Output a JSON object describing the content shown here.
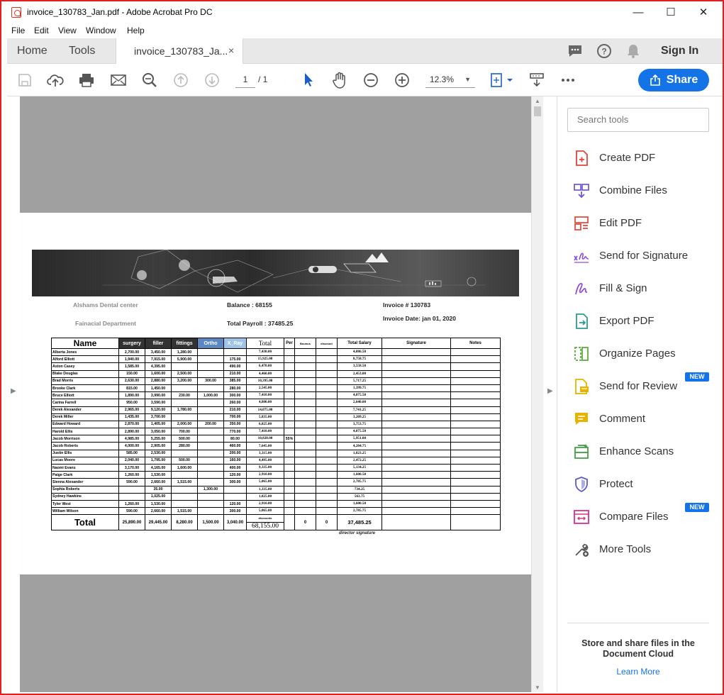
{
  "window": {
    "title": "invoice_130783_Jan.pdf - Adobe Acrobat Pro DC",
    "minimize": "—",
    "maximize": "☐",
    "close": "✕"
  },
  "menu": [
    "File",
    "Edit",
    "View",
    "Window",
    "Help"
  ],
  "tabs": {
    "home": "Home",
    "tools": "Tools",
    "document": "invoice_130783_Ja...",
    "close": "×",
    "sign_in": "Sign In"
  },
  "toolbar": {
    "page_current": "1",
    "page_total": "/ 1",
    "zoom": "12.3%",
    "share": "Share"
  },
  "invoice": {
    "company": "Alshams Dental center",
    "department": "Fainacial Department",
    "balance": "Balance : 68155",
    "total_payroll": "Total Payroll : 37485.25",
    "invoice_no": "Invoice # 130783",
    "invoice_date": "Invoice Date: jan 01, 2020",
    "director_signature": "director signature",
    "headers": [
      "Name",
      "surgery",
      "filler",
      "fittings",
      "Ortho",
      "X_Ray",
      "Total",
      "Per",
      "Bounus",
      "discount",
      "Total Salary",
      "Signature",
      "Notes"
    ],
    "rows": [
      {
        "name": "Alberta Jones",
        "surgery": "2,700.00",
        "filler": "3,450.00",
        "fittings": "1,280.00",
        "ortho": "",
        "xray": "",
        "total": "7,430.00",
        "per": "",
        "salary": "4,086.50"
      },
      {
        "name": "Alford Elliott",
        "surgery": "1,940.00",
        "filler": "7,915.00",
        "fittings": "5,900.00",
        "ortho": "",
        "xray": "175.00",
        "total": "15,925.00",
        "per": "",
        "salary": "8,758.75"
      },
      {
        "name": "Aston Casey",
        "surgery": "1,585.00",
        "filler": "4,395.00",
        "fittings": "",
        "ortho": "",
        "xray": "490.00",
        "total": "6,470.00",
        "per": "",
        "salary": "3,558.50"
      },
      {
        "name": "Blake Douglas",
        "surgery": "150.00",
        "filler": "1,600.00",
        "fittings": "2,500.00",
        "ortho": "",
        "xray": "210.00",
        "total": "4,460.00",
        "per": "",
        "salary": "2,453.00"
      },
      {
        "name": "Brad Morris",
        "surgery": "2,630.00",
        "filler": "2,880.00",
        "fittings": "3,200.00",
        "ortho": "300.00",
        "xray": "385.00",
        "total": "10,395.00",
        "per": "",
        "salary": "5,717.25"
      },
      {
        "name": "Brooke Clark",
        "surgery": "815.00",
        "filler": "1,450.00",
        "fittings": "",
        "ortho": "",
        "xray": "280.00",
        "total": "2,545.00",
        "per": "",
        "salary": "1,399.75"
      },
      {
        "name": "Bruce Elliott",
        "surgery": "1,890.00",
        "filler": "3,990.00",
        "fittings": "230.00",
        "ortho": "1,000.00",
        "xray": "300.00",
        "total": "7,410.00",
        "per": "",
        "salary": "4,075.50"
      },
      {
        "name": "Carina Farrell",
        "surgery": "950.00",
        "filler": "3,590.00",
        "fittings": "",
        "ortho": "",
        "xray": "260.00",
        "total": "4,800.00",
        "per": "",
        "salary": "2,640.00"
      },
      {
        "name": "Derek Alexander",
        "surgery": "2,965.00",
        "filler": "9,120.00",
        "fittings": "1,780.00",
        "ortho": "",
        "xray": "210.00",
        "total": "14,075.00",
        "per": "",
        "salary": "7,741.25"
      },
      {
        "name": "Derek Miller",
        "surgery": "1,435.00",
        "filler": "3,700.00",
        "fittings": "",
        "ortho": "",
        "xray": "700.00",
        "total": "5,835.00",
        "per": "",
        "salary": "3,209.25"
      },
      {
        "name": "Edward Howard",
        "surgery": "2,870.00",
        "filler": "1,405.00",
        "fittings": "2,000.00",
        "ortho": "200.00",
        "xray": "350.00",
        "total": "6,825.00",
        "per": "",
        "salary": "3,753.75"
      },
      {
        "name": "Harold Ellis",
        "surgery": "2,890.00",
        "filler": "3,050.00",
        "fittings": "700.00",
        "ortho": "",
        "xray": "770.00",
        "total": "7,410.00",
        "per": "",
        "salary": "4,075.50"
      },
      {
        "name": "Jacob Morrison",
        "surgery": "4,985.00",
        "filler": "5,255.00",
        "fittings": "500.00",
        "ortho": "",
        "xray": "80.00",
        "total": "10,820.00",
        "per": "55%",
        "salary": "5,951.00"
      },
      {
        "name": "Jacob Roberts",
        "surgery": "4,000.00",
        "filler": "2,905.00",
        "fittings": "280.00",
        "ortho": "",
        "xray": "460.00",
        "total": "7,645.00",
        "per": "",
        "salary": "4,204.75"
      },
      {
        "name": "Justin Ellis",
        "surgery": "585.00",
        "filler": "2,530.00",
        "fittings": "",
        "ortho": "",
        "xray": "200.00",
        "total": "3,315.00",
        "per": "",
        "salary": "1,823.25"
      },
      {
        "name": "Lucas Moore",
        "surgery": "2,040.00",
        "filler": "1,795.00",
        "fittings": "500.00",
        "ortho": "",
        "xray": "160.00",
        "total": "4,495.00",
        "per": "",
        "salary": "2,472.25"
      },
      {
        "name": "Naomi Evans",
        "surgery": "3,170.00",
        "filler": "4,165.00",
        "fittings": "1,600.00",
        "ortho": "",
        "xray": "400.00",
        "total": "9,335.00",
        "per": "",
        "salary": "5,134.25"
      },
      {
        "name": "Paige Clark",
        "surgery": "1,260.00",
        "filler": "1,530.00",
        "fittings": "",
        "ortho": "",
        "xray": "120.00",
        "total": "2,910.00",
        "per": "",
        "salary": "1,600.50"
      },
      {
        "name": "Sienna Alexander",
        "surgery": "590.00",
        "filler": "2,660.00",
        "fittings": "1,515.00",
        "ortho": "",
        "xray": "300.00",
        "total": "5,065.00",
        "per": "",
        "salary": "2,785.75"
      },
      {
        "name": "Sophia Roberts",
        "surgery": "",
        "filler": "35.00",
        "fittings": "",
        "ortho": "1,300.00",
        "xray": "",
        "total": "1,335.00",
        "per": "",
        "salary": "734.25"
      },
      {
        "name": "Sydney Hawkins",
        "surgery": "",
        "filler": "1,025.00",
        "fittings": "",
        "ortho": "",
        "xray": "",
        "total": "1,025.00",
        "per": "",
        "salary": "563.75"
      },
      {
        "name": "Tyler West",
        "surgery": "1,260.00",
        "filler": "1,530.00",
        "fittings": "",
        "ortho": "",
        "xray": "120.00",
        "total": "2,910.00",
        "per": "",
        "salary": "1,600.50"
      },
      {
        "name": "William Wilson",
        "surgery": "590.00",
        "filler": "2,660.00",
        "fittings": "1,515.00",
        "ortho": "",
        "xray": "300.00",
        "total": "5,065.00",
        "per": "",
        "salary": "2,785.75"
      }
    ],
    "totals": {
      "label": "Total",
      "surgery": "25,890.00",
      "filler": "29,445.00",
      "fittings": "8,280.00",
      "ortho": "1,500.00",
      "xray": "3,040.00",
      "discounts_label": "discounts",
      "total": "68,155.00",
      "bonus": "0",
      "discount": "0",
      "salary": "37,485.25"
    }
  },
  "right_pane": {
    "search_placeholder": "Search tools",
    "tools": [
      {
        "label": "Create PDF",
        "icon": "create-pdf-icon",
        "color": "#e0463a"
      },
      {
        "label": "Combine Files",
        "icon": "combine-files-icon",
        "color": "#6a56d8"
      },
      {
        "label": "Edit PDF",
        "icon": "edit-pdf-icon",
        "color": "#e0463a"
      },
      {
        "label": "Send for Signature",
        "icon": "send-signature-icon",
        "color": "#8d4fd8"
      },
      {
        "label": "Fill & Sign",
        "icon": "fill-sign-icon",
        "color": "#8d4fd8"
      },
      {
        "label": "Export PDF",
        "icon": "export-pdf-icon",
        "color": "#2d9a8c"
      },
      {
        "label": "Organize Pages",
        "icon": "organize-pages-icon",
        "color": "#55a832"
      },
      {
        "label": "Send for Review",
        "icon": "send-review-icon",
        "color": "#e6b400"
      },
      {
        "label": "Comment",
        "icon": "comment-icon",
        "color": "#e6b400"
      },
      {
        "label": "Enhance Scans",
        "icon": "enhance-scans-icon",
        "color": "#3c9a3c"
      },
      {
        "label": "Protect",
        "icon": "protect-icon",
        "color": "#5b5bc8"
      },
      {
        "label": "Compare Files",
        "icon": "compare-files-icon",
        "color": "#d8328c"
      },
      {
        "label": "More Tools",
        "icon": "more-tools-icon",
        "color": "#555555"
      }
    ],
    "new_badge": "NEW",
    "cloud_text": "Store and share files in the Document Cloud",
    "learn_more": "Learn More"
  }
}
